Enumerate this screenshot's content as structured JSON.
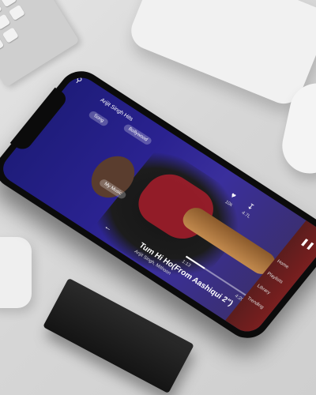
{
  "player": {
    "song_title": "Tum Hi Ho(From Aashiqui 2\")",
    "song_subtitle": "Arijit Singh, Mithoon",
    "playlist_label": "Arijit Singh Hits",
    "tag_label": "Song",
    "genre_label": "Bollywood",
    "chip_label": "My Music",
    "like_count": "10k",
    "download_label": "4.7L",
    "elapsed_time": "1:13",
    "total_time": "4:20",
    "progress": 0.28,
    "tabs": [
      "Home",
      "Playlists",
      "Library",
      "Trending"
    ]
  }
}
